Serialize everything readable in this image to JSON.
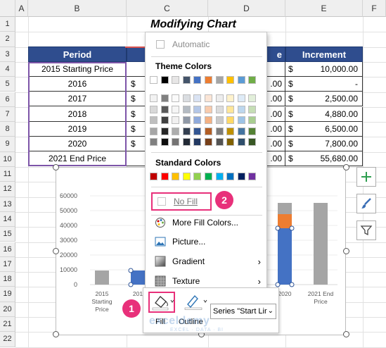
{
  "columns": [
    "",
    "A",
    "B",
    "C",
    "D",
    "E",
    "F"
  ],
  "rows": [
    "1",
    "2",
    "3",
    "4",
    "5",
    "6",
    "7",
    "8",
    "9",
    "10",
    "11",
    "12",
    "13",
    "14",
    "15",
    "16",
    "17",
    "18",
    "19",
    "20",
    "21",
    "22"
  ],
  "title": "Modifying Chart",
  "table": {
    "headers": {
      "period": "Period",
      "c": "",
      "d": "e",
      "increment": "Increment"
    },
    "rows": [
      {
        "period": "2015 Starting Price",
        "c": "",
        "d": "",
        "cur": "$",
        "inc": "10,000.00"
      },
      {
        "period": "2016",
        "c": "$",
        "d": ".00",
        "cur": "$",
        "inc": "-"
      },
      {
        "period": "2017",
        "c": "$",
        "d": ".00",
        "cur": "$",
        "inc": "2,500.00"
      },
      {
        "period": "2018",
        "c": "$",
        "d": ".00",
        "cur": "$",
        "inc": "4,880.00"
      },
      {
        "period": "2019",
        "c": "$",
        "d": ".00",
        "cur": "$",
        "inc": "6,500.00"
      },
      {
        "period": "2020",
        "c": "$",
        "d": ".00",
        "cur": "$",
        "inc": "7,800.00"
      },
      {
        "period": "2021 End Price",
        "c": "",
        "d": ".00",
        "cur": "$",
        "inc": "55,680.00"
      }
    ]
  },
  "chart": {
    "y_ticks": [
      "60000",
      "50000",
      "40000",
      "30000",
      "20000",
      "10000",
      "0"
    ],
    "x_labels": [
      "2015\nStarting\nPrice",
      "201",
      "",
      "",
      "2020",
      "2021 End\nPrice"
    ]
  },
  "menu": {
    "automatic": "Automatic",
    "theme_colors_label": "Theme Colors",
    "standard_colors_label": "Standard Colors",
    "no_fill": "No Fill",
    "more_fill_colors": "More Fill Colors...",
    "picture": "Picture...",
    "gradient": "Gradient",
    "texture": "Texture",
    "theme_top": [
      "#ffffff",
      "#000000",
      "#e7e6e6",
      "#44546a",
      "#4472c4",
      "#ed7d31",
      "#a5a5a5",
      "#ffc000",
      "#5b9bd5",
      "#70ad47"
    ],
    "standard": [
      "#c00000",
      "#ff0000",
      "#ffc000",
      "#ffff00",
      "#92d050",
      "#00b050",
      "#00b0f0",
      "#0070c0",
      "#002060",
      "#7030a0"
    ]
  },
  "toolbar": {
    "fill_label": "Fill",
    "outline_label": "Outline",
    "series_select": "Series \"Start Lir"
  },
  "badges": {
    "one": "1",
    "two": "2"
  },
  "watermark": "exceldemy",
  "watermark_sub": "EXCEL · DATA · BI"
}
